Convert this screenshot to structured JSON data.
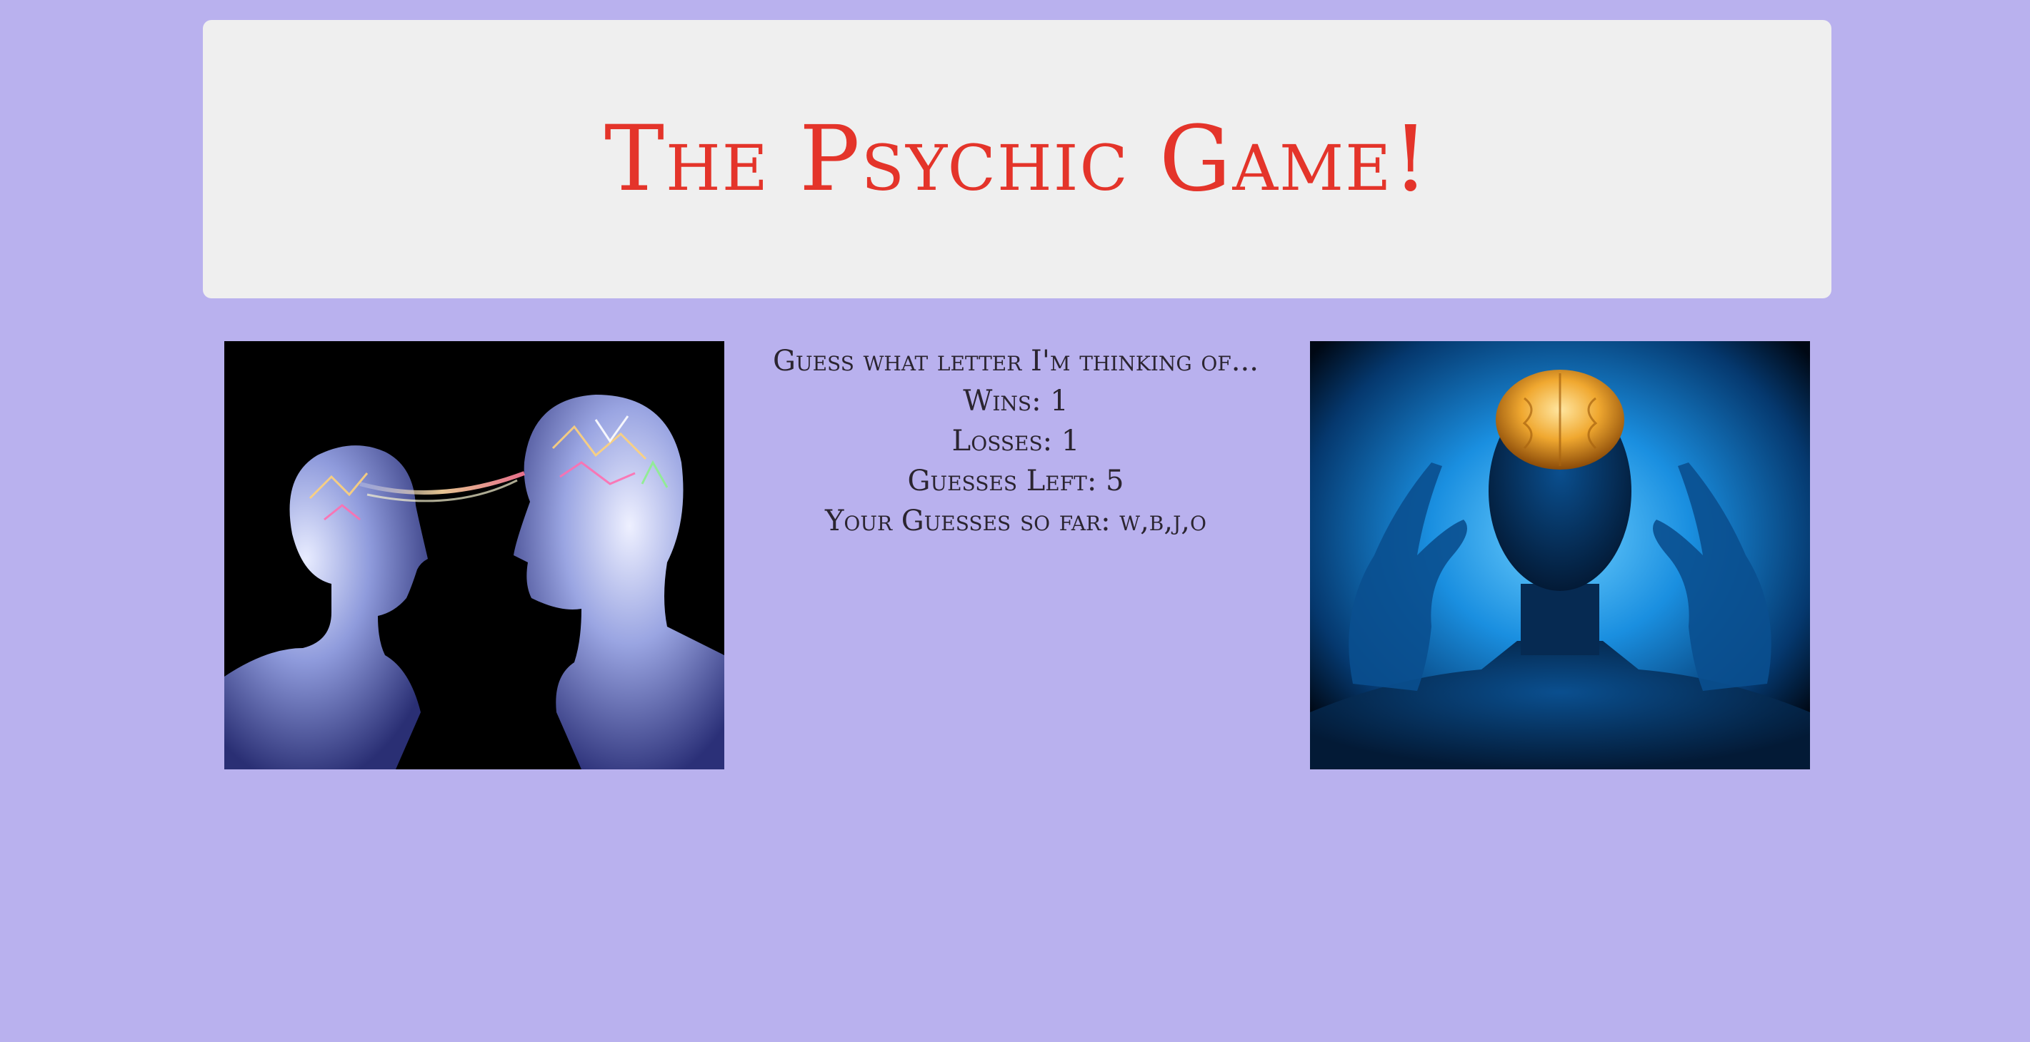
{
  "header": {
    "title": "The Psychic Game!"
  },
  "game": {
    "prompt": "Guess what letter I'm thinking of...",
    "wins_label": "Wins: ",
    "wins": "1",
    "losses_label": "Losses: ",
    "losses": "1",
    "guesses_left_label": "Guesses Left: ",
    "guesses_left": "5",
    "guesses_so_far_label": "Your Guesses so far: ",
    "guesses_so_far": "w,b,j,o"
  },
  "images": {
    "left": "two-heads-telepathy-illustration",
    "right": "glowing-brain-man-illustration"
  },
  "colors": {
    "background": "#b9b1ee",
    "jumbotron": "#efefef",
    "title": "#e4342a",
    "text": "#2b2530"
  }
}
